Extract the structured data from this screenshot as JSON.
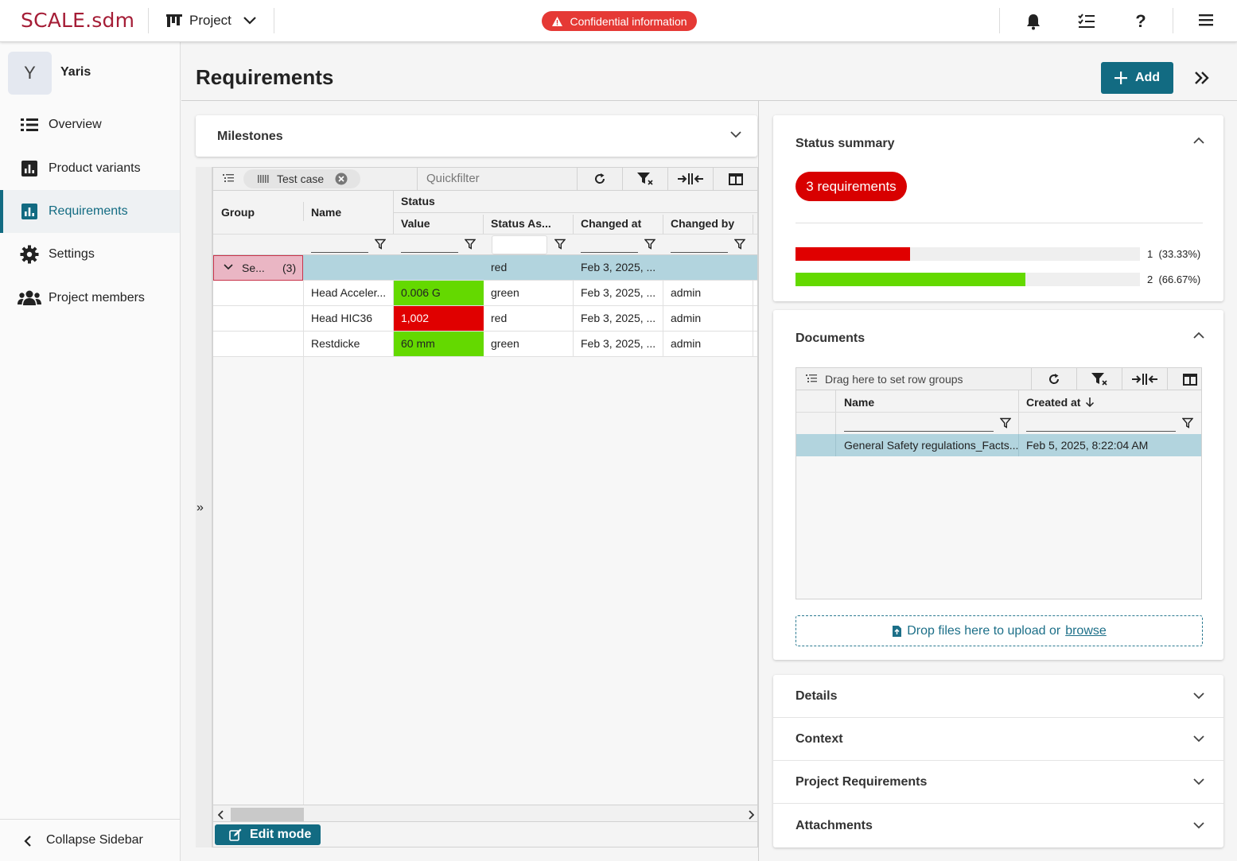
{
  "topbar": {
    "logo": "SCALE.sdm",
    "project_menu": "Project",
    "confidential": "Confidential information",
    "icons": [
      "bell-icon",
      "task-list-icon",
      "help-icon",
      "menu-icon"
    ]
  },
  "sidebar": {
    "avatar_letter": "Y",
    "project_name": "Yaris",
    "items": [
      {
        "label": "Overview",
        "icon": "list-icon"
      },
      {
        "label": "Product variants",
        "icon": "chart-icon"
      },
      {
        "label": "Requirements",
        "icon": "chart-icon",
        "active": true
      },
      {
        "label": "Settings",
        "icon": "gear-icon"
      },
      {
        "label": "Project members",
        "icon": "users-icon"
      }
    ],
    "collapse_label": "Collapse Sidebar"
  },
  "header": {
    "title": "Requirements",
    "add_label": "Add"
  },
  "milestones": {
    "title": "Milestones"
  },
  "grid": {
    "group_chip": "Test case",
    "quickfilter_placeholder": "Quickfilter",
    "columns": {
      "group": "Group",
      "name": "Name",
      "status": "Status",
      "value": "Value",
      "status_assessment": "Status As...",
      "changed_at": "Changed at",
      "changed_by": "Changed by"
    },
    "group_row": {
      "name": "Se...",
      "count": "(3)",
      "status": "red",
      "changed_at": "Feb 3, 2025, ..."
    },
    "rows": [
      {
        "name": "Head Acceler...",
        "value": "0.006 G",
        "status": "green",
        "changed_at": "Feb 3, 2025, ...",
        "changed_by": "admin",
        "value_color": "#64d900"
      },
      {
        "name": "Head HIC36",
        "value": "1,002",
        "status": "red",
        "changed_at": "Feb 3, 2025, ...",
        "changed_by": "admin",
        "value_color": "#e00000"
      },
      {
        "name": "Restdicke",
        "value": "60 mm",
        "status": "green",
        "changed_at": "Feb 3, 2025, ...",
        "changed_by": "admin",
        "value_color": "#64d900"
      }
    ],
    "edit_mode_label": "Edit mode"
  },
  "status_summary": {
    "title": "Status summary",
    "pill": "3 requirements",
    "bars": [
      {
        "count": "1",
        "percent": "(33.33%)",
        "fraction": 0.3333,
        "color": "#e00000"
      },
      {
        "count": "2",
        "percent": "(66.67%)",
        "fraction": 0.6667,
        "color": "#64d900"
      }
    ]
  },
  "documents": {
    "title": "Documents",
    "drag_hint": "Drag here to set row groups",
    "col_name": "Name",
    "col_created": "Created at",
    "rows": [
      {
        "name": "General Safety regulations_Facts...",
        "created": "Feb 5, 2025, 8:22:04 AM"
      }
    ],
    "upload_text": "Drop files here to upload or",
    "upload_link": "browse"
  },
  "accordions": [
    "Details",
    "Context",
    "Project Requirements",
    "Attachments"
  ]
}
